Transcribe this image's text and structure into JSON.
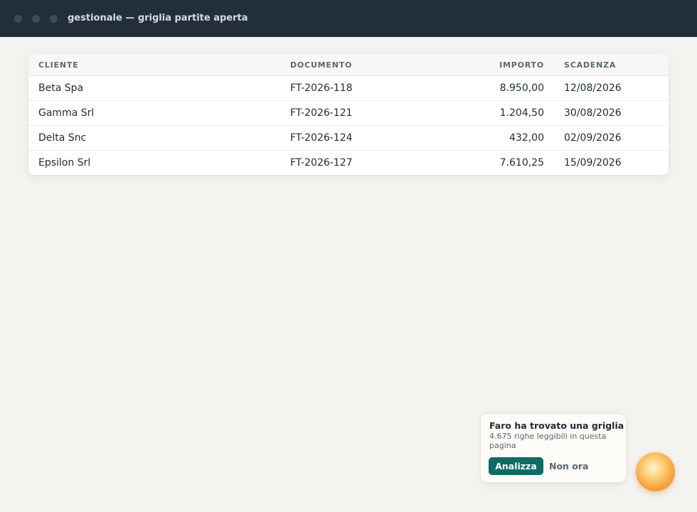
{
  "window": {
    "title": "gestionale — griglia partite aperta"
  },
  "grid": {
    "columns": {
      "cliente": "CLIENTE",
      "documento": "DOCUMENTO",
      "importo": "IMPORTO",
      "scadenza": "SCADENZA"
    },
    "rows": [
      {
        "cliente": "Beta Spa",
        "documento": "FT-2026-118",
        "importo": "8.950,00",
        "scadenza": "12/08/2026"
      },
      {
        "cliente": "Gamma Srl",
        "documento": "FT-2026-121",
        "importo": "1.204,50",
        "scadenza": "30/08/2026"
      },
      {
        "cliente": "Delta Snc",
        "documento": "FT-2026-124",
        "importo": "432,00",
        "scadenza": "02/09/2026"
      },
      {
        "cliente": "Epsilon Srl",
        "documento": "FT-2026-127",
        "importo": "7.610,25",
        "scadenza": "15/09/2026"
      }
    ]
  },
  "assistant": {
    "title": "Faro ha trovato una griglia",
    "message": "4.675 righe leggibili in questa pagina",
    "primary_label": "Analizza",
    "secondary_label": "Non ora",
    "icon": "assistant-orb-icon"
  },
  "colors": {
    "titlebar": "#222f3a",
    "accent": "#0f6b63",
    "orb": "#f7a640"
  }
}
